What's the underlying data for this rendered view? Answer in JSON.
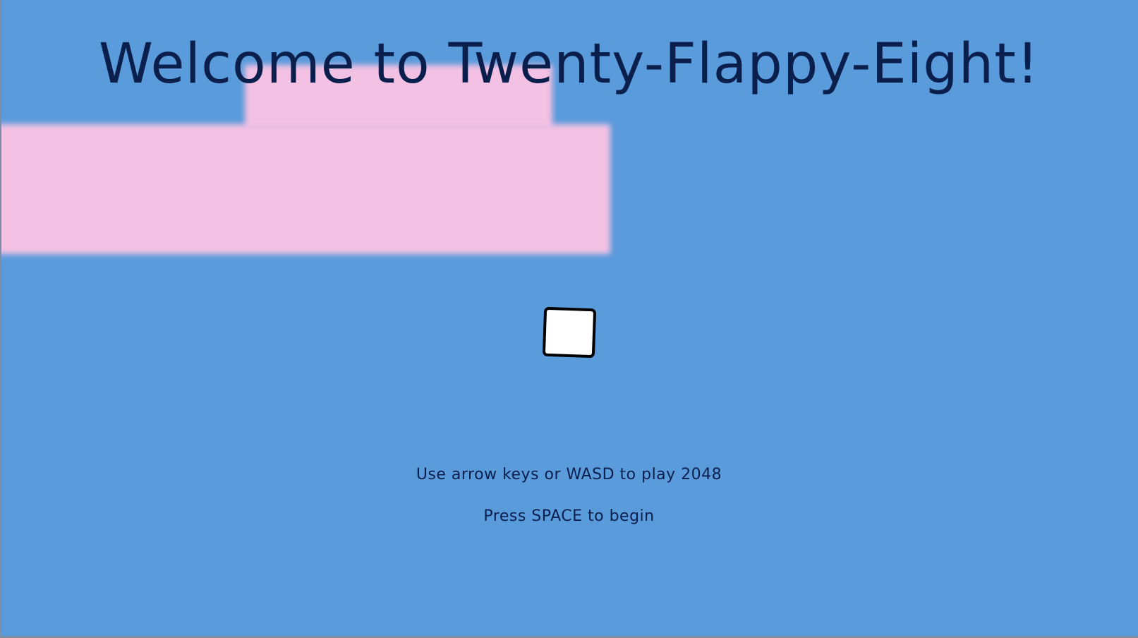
{
  "game": {
    "title": "Welcome to Twenty-Flappy-Eight!",
    "instructions": {
      "controls": "Use arrow keys or WASD to play 2048",
      "start": "Press SPACE to begin"
    },
    "player": {
      "shape": "rounded-square",
      "fill_color": "#ffffff",
      "border_color": "#000000"
    },
    "colors": {
      "background": "#5a9bdc",
      "obstacle": "#f3c1e3",
      "text": "#0b1f4d"
    }
  }
}
